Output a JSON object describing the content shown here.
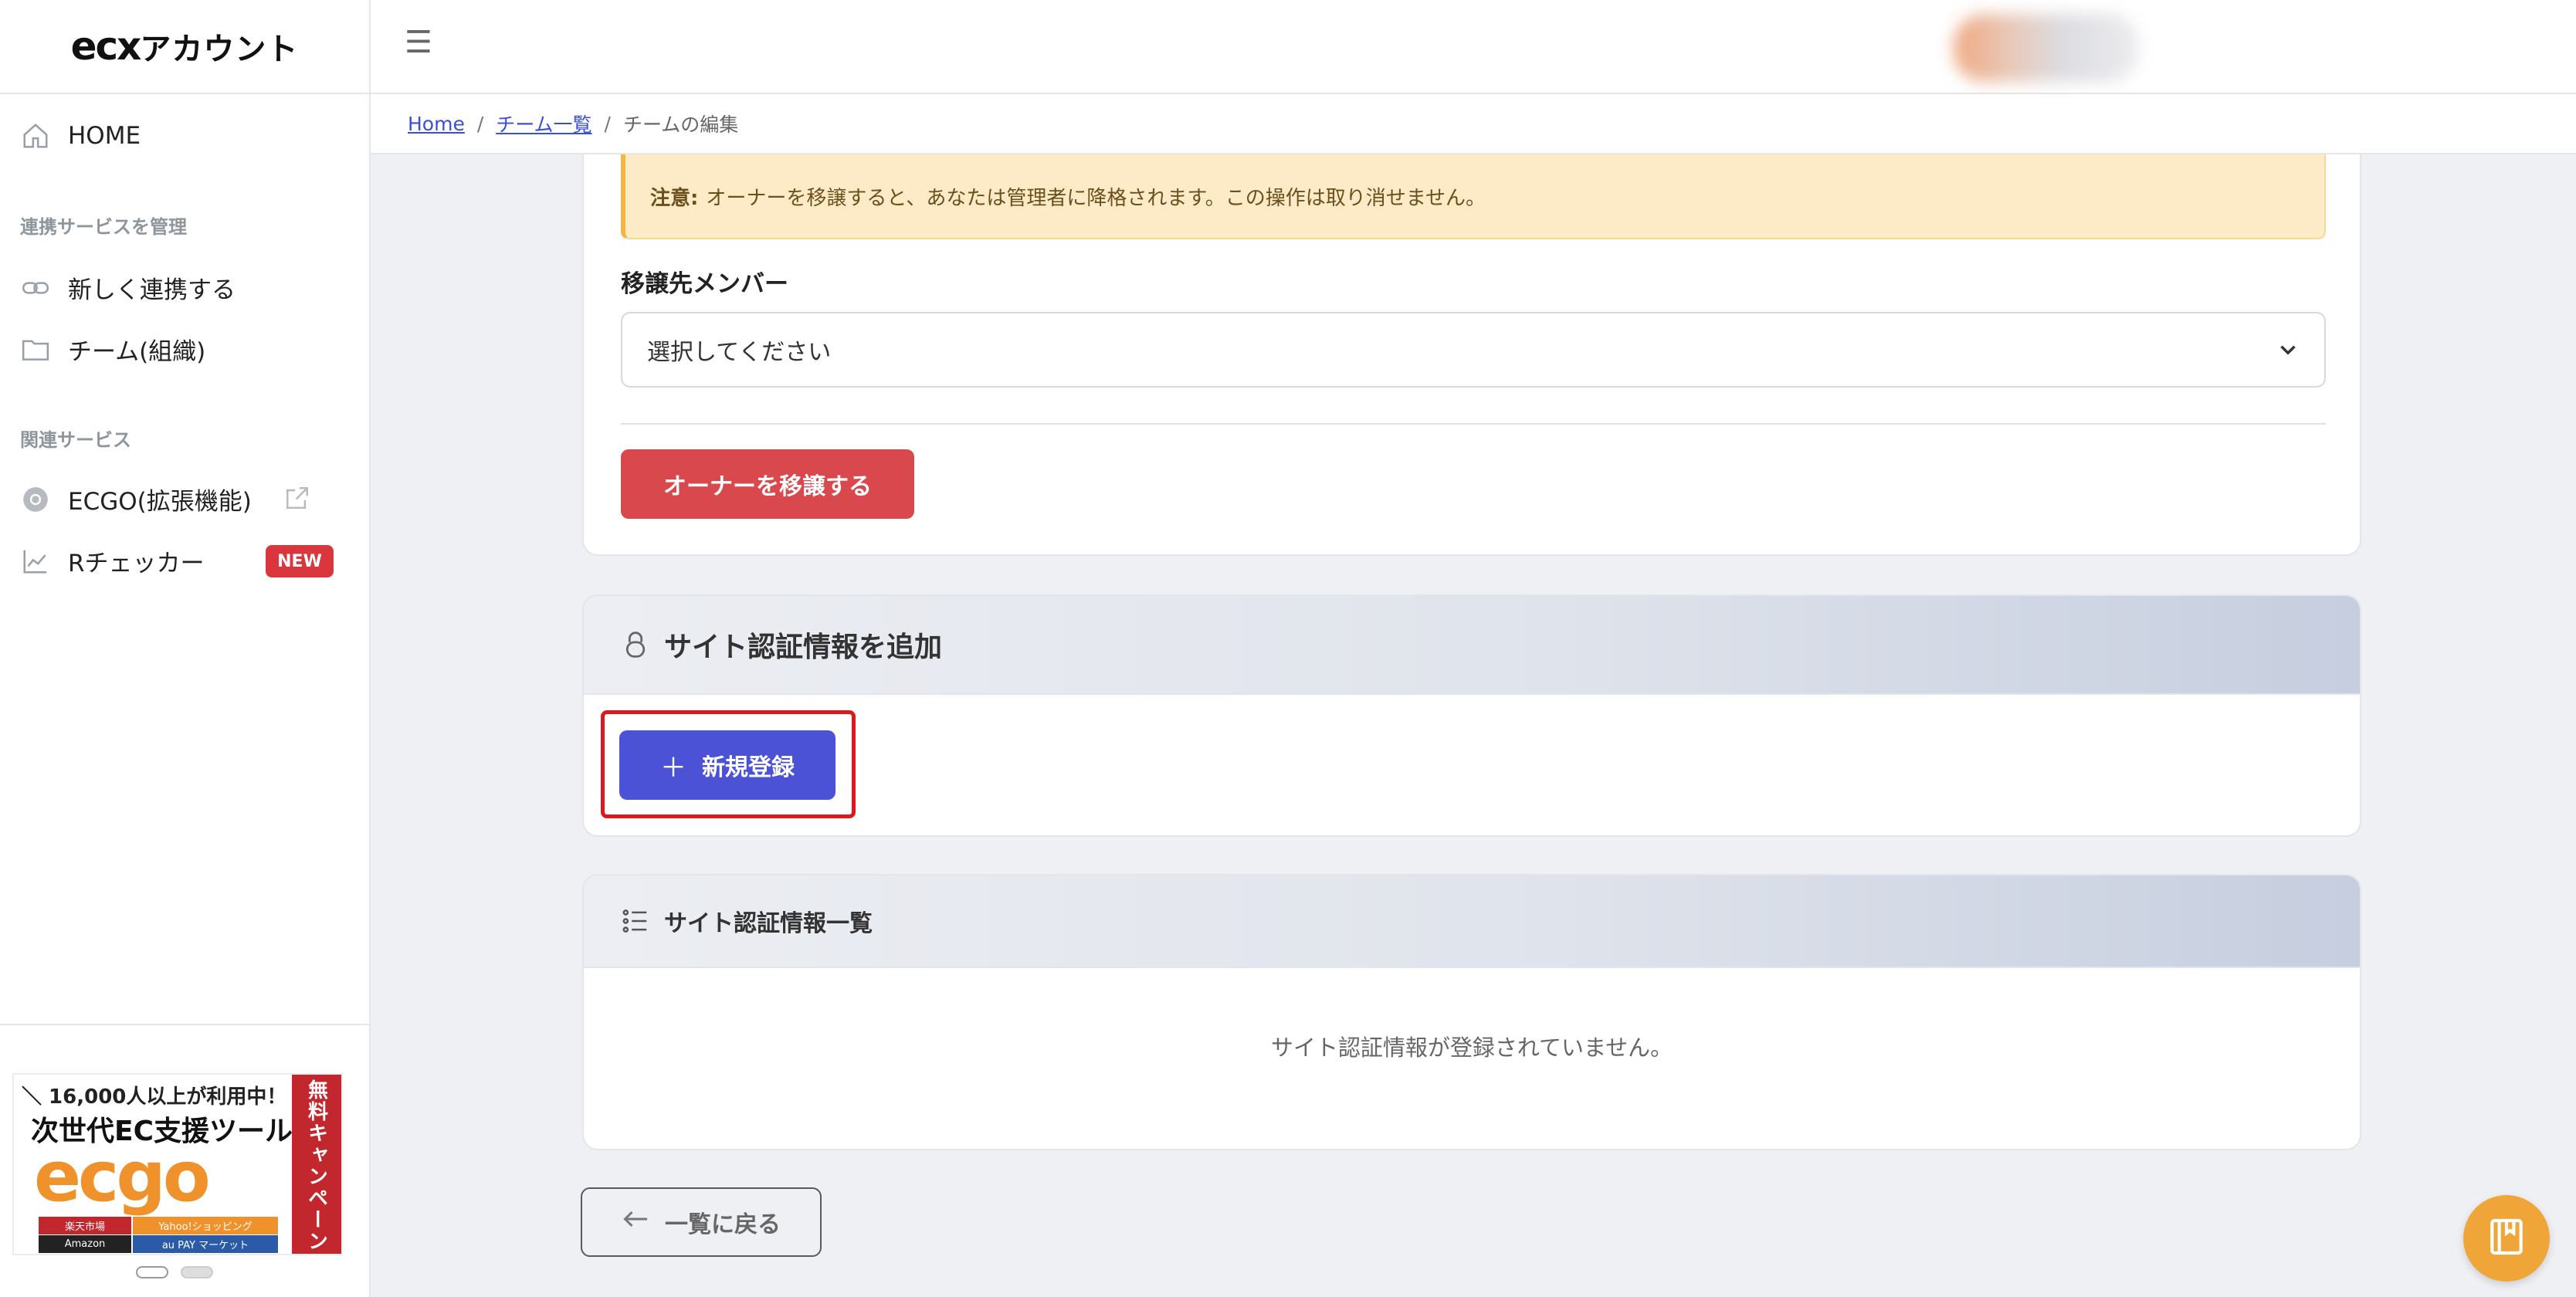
{
  "app": {
    "logo_brand": "ecx",
    "logo_suffix": "アカウント"
  },
  "sidebar": {
    "home": "HOME",
    "section_manage": "連携サービスを管理",
    "link_new": "新しく連携する",
    "teams": "チーム(組織)",
    "section_related": "関連サービス",
    "ecgo": "ECGO(拡張機能)",
    "rchecker": "Rチェッカー",
    "new_badge": "NEW"
  },
  "banner": {
    "top_line": "＼ 16,000人以上が利用中！ ／",
    "main_line": "次世代EC支援ツール",
    "logo": "ecgo",
    "side_text": "無料キャンペーン",
    "markets": [
      "楽天市場",
      "Yahoo!ショッピング",
      "Amazon",
      "au PAY マーケット"
    ]
  },
  "header": {
    "menu_icon": "hamburger-icon"
  },
  "breadcrumb": {
    "home": "Home",
    "teams": "チーム一覧",
    "current": "チームの編集",
    "sep": "/"
  },
  "transfer": {
    "warning_label": "注意:",
    "warning_text": "オーナーを移譲すると、あなたは管理者に降格されます。この操作は取り消せません。",
    "field_label": "移譲先メンバー",
    "select_value": "選択してください",
    "button": "オーナーを移譲する"
  },
  "add_site_auth": {
    "title": "サイト認証情報を追加",
    "button": "新規登録"
  },
  "site_auth_list": {
    "title": "サイト認証情報一覧",
    "empty": "サイト認証情報が登録されていません。"
  },
  "back_button": "一覧に戻る",
  "colors": {
    "primary": "#4b52d6",
    "danger": "#d9484c",
    "warning_bg": "#fdebc8",
    "badge": "#d9363e",
    "fab": "#f0a539",
    "highlight": "#e0161e"
  }
}
